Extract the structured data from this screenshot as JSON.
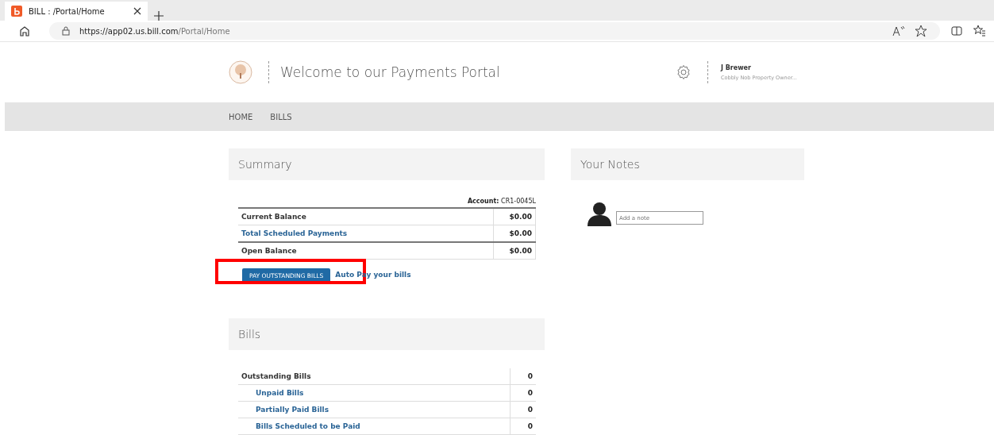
{
  "browser": {
    "tab_title": "BILL : /Portal/Home",
    "url_host": "https://app02.us.bill.com",
    "url_path": "/Portal/Home"
  },
  "header": {
    "title": "Welcome to our Payments Portal",
    "user_name": "J Brewer",
    "user_org": "Cobbly Nob Property Owner..."
  },
  "nav": [
    {
      "label": "HOME",
      "selected": false
    },
    {
      "label": "BILLS",
      "selected": false
    }
  ],
  "summary": {
    "title": "Summary",
    "account_label": "Account:",
    "account": "CR1-0045L",
    "rows": [
      {
        "label": "Current Balance",
        "value": "$0.00",
        "kind": "plain"
      },
      {
        "label": "Total Scheduled Payments",
        "value": "$0.00",
        "kind": "link"
      },
      {
        "label": "Open Balance",
        "value": "$0.00",
        "kind": "plain"
      }
    ],
    "pay_button": {
      "label": "PAY OUTSTANDING BILLS",
      "highlighted": true
    },
    "autopay_link": "Auto Pay your bills"
  },
  "notes": {
    "title": "Your Notes",
    "placeholder": "Add a note"
  },
  "bills": {
    "title": "Bills",
    "rows": [
      {
        "label": "Outstanding Bills",
        "value": "0",
        "children": [
          {
            "label": "Unpaid Bills",
            "value": "0"
          },
          {
            "label": "Partially Paid Bills",
            "value": "0"
          },
          {
            "label": "Bills Scheduled to be Paid",
            "value": "0"
          }
        ]
      }
    ]
  }
}
